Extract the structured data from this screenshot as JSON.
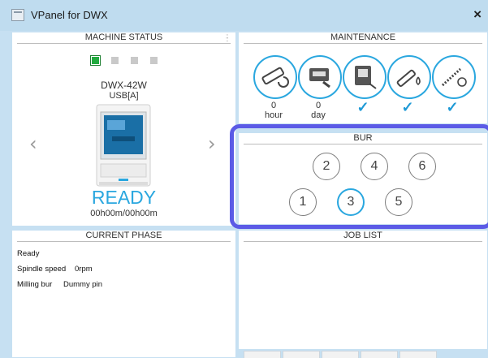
{
  "window": {
    "title": "VPanel for DWX",
    "close": "×"
  },
  "machine_status": {
    "header": "MACHINE STATUS",
    "model": "DWX-42W",
    "connection": "USB[A]",
    "state": "READY",
    "time": "00h00m/00h00m",
    "prev": "‹",
    "next": "›",
    "active_color": "#22aa3f",
    "ready_color": "#2aa7df"
  },
  "maintenance": {
    "header": "MAINTENANCE",
    "items": [
      {
        "icon": "spindle-rotate-icon",
        "value": "0",
        "unit": "hour"
      },
      {
        "icon": "cleaning-machine-icon",
        "value": "0",
        "unit": "day"
      },
      {
        "icon": "dust-collector-icon",
        "status": "✓"
      },
      {
        "icon": "spindle-oil-icon",
        "status": "✓"
      },
      {
        "icon": "bur-maintenance-icon",
        "status": "✓"
      }
    ]
  },
  "bur": {
    "header": "BUR",
    "slots": [
      "1",
      "2",
      "3",
      "4",
      "5",
      "6"
    ],
    "selected": "3"
  },
  "current_phase": {
    "header": "CURRENT PHASE",
    "status": "Ready",
    "spindle_label": "Spindle speed",
    "spindle_value": "0rpm",
    "bur_label": "Milling bur",
    "bur_value": "Dummy pin"
  },
  "job_list": {
    "header": "JOB LIST"
  }
}
